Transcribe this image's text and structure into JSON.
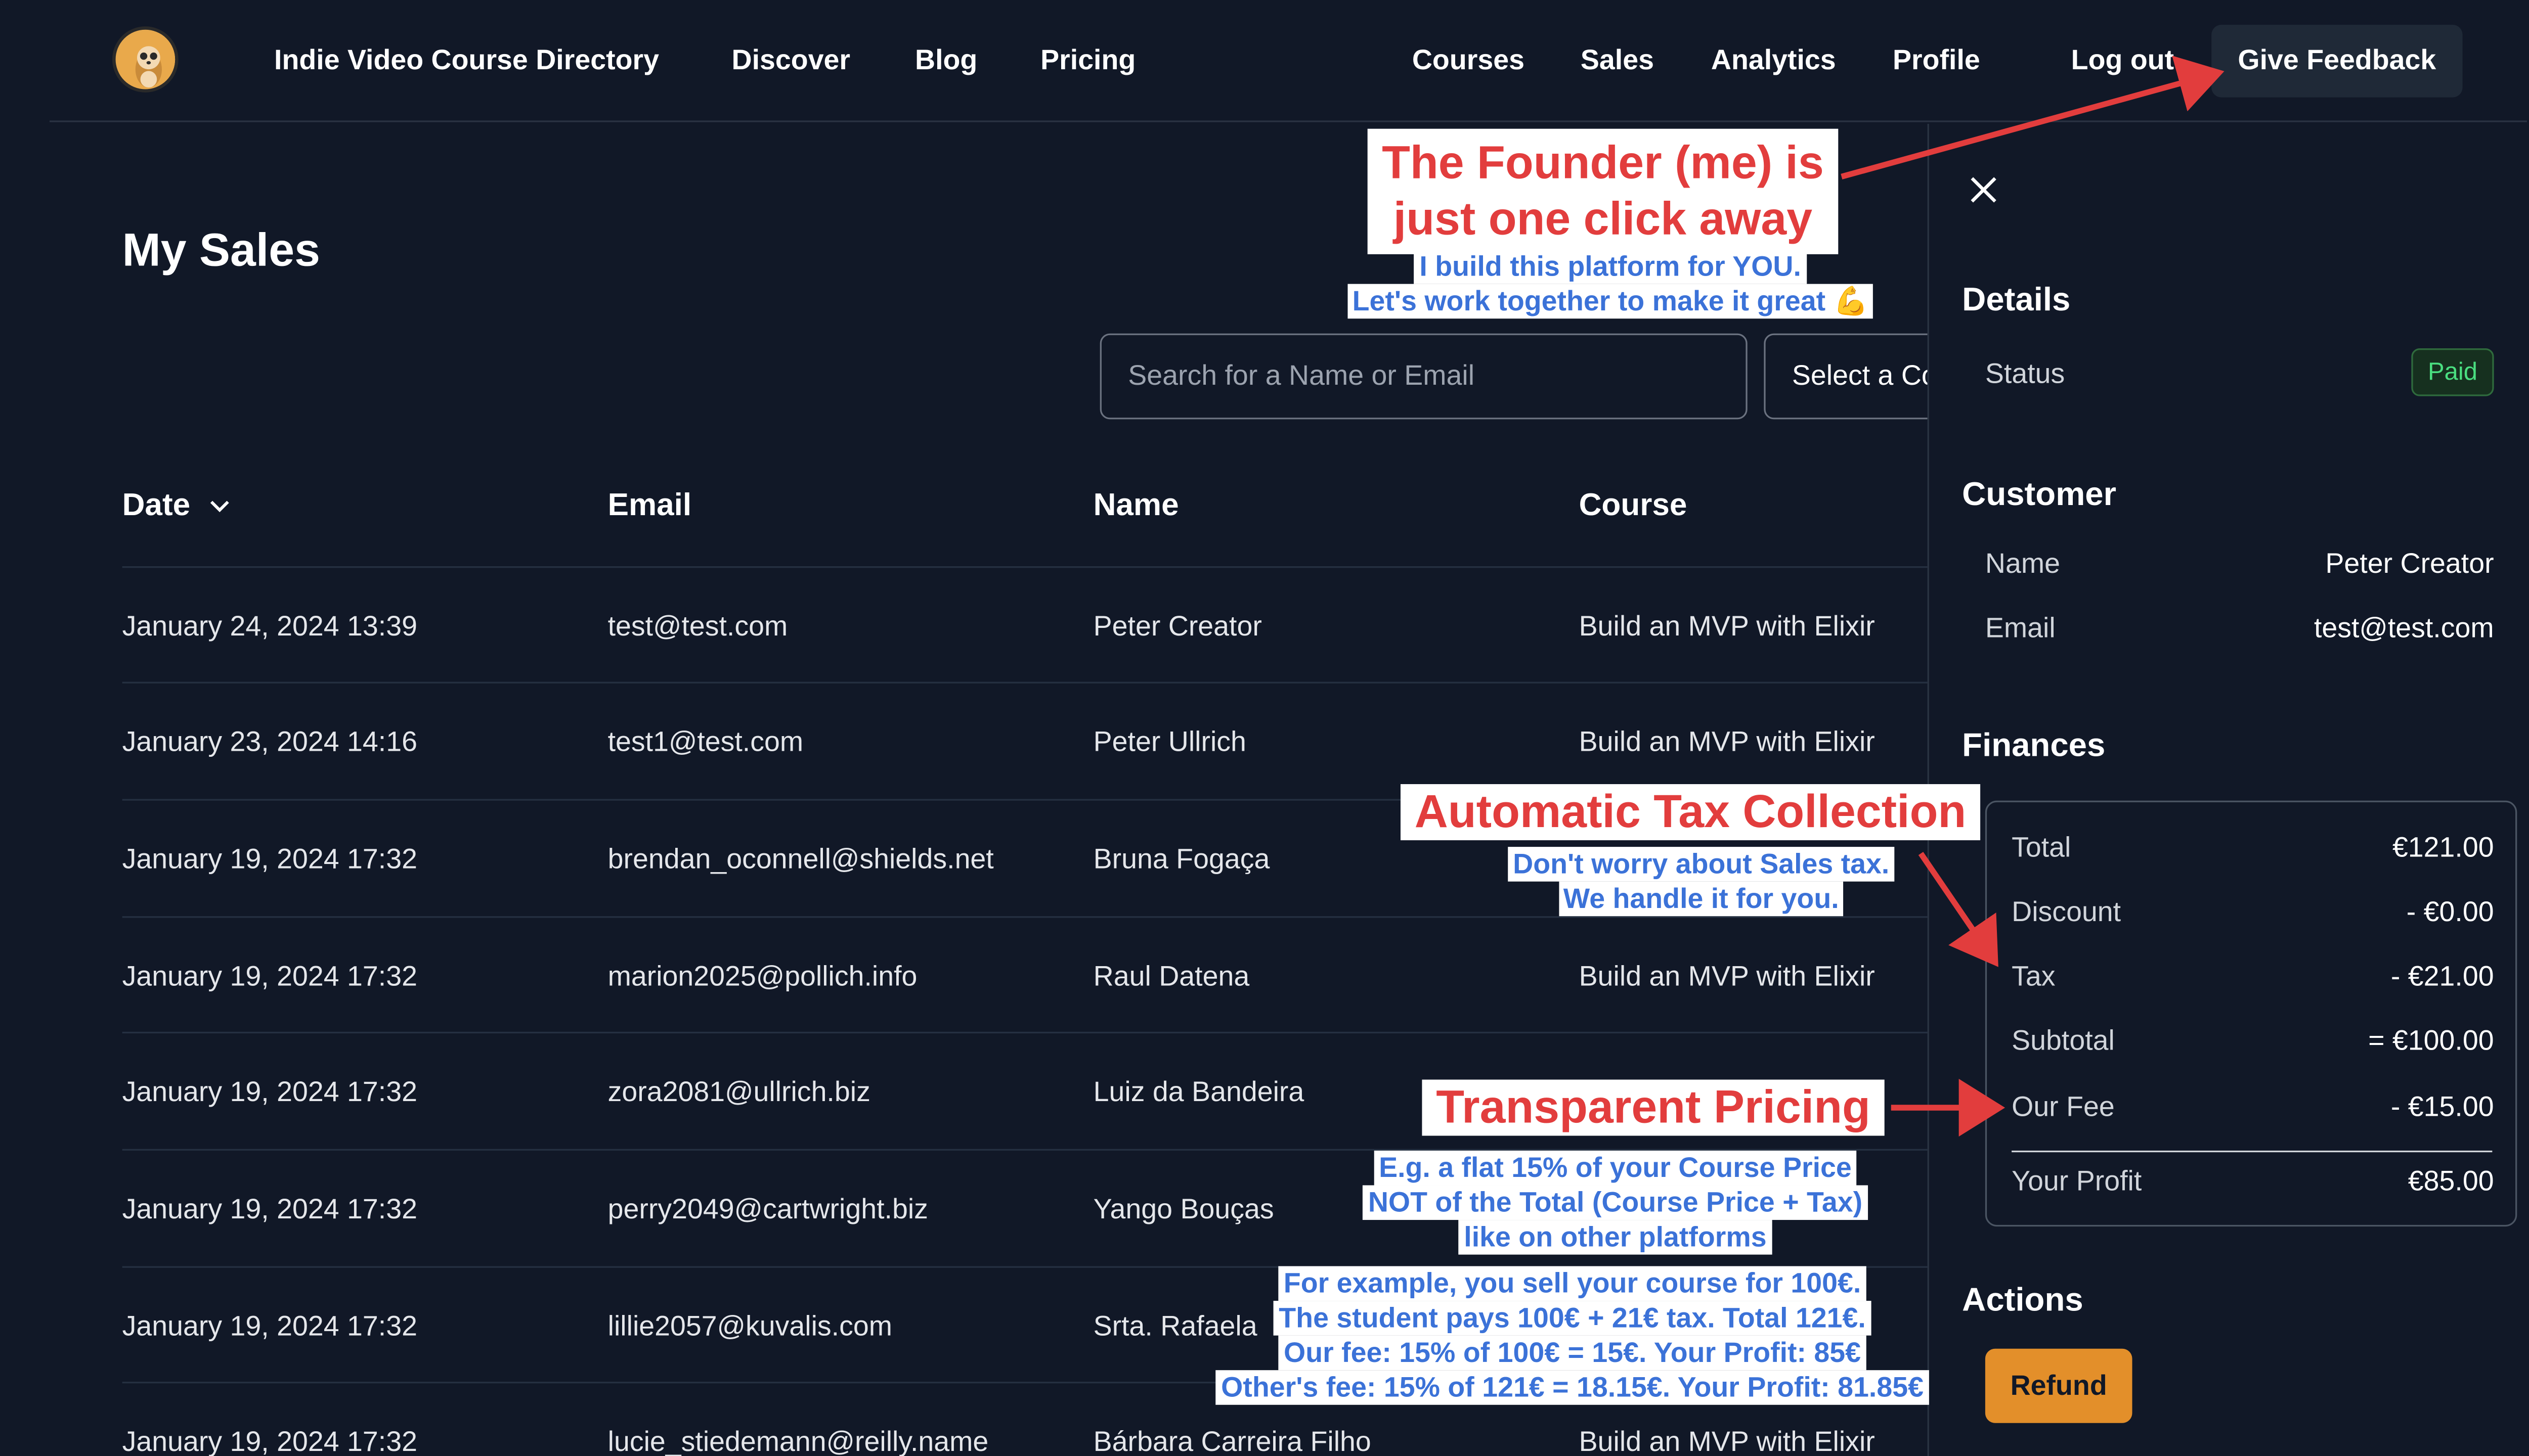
{
  "nav": {
    "brand": "Indie Video Course Directory",
    "left_links": [
      "Discover",
      "Blog",
      "Pricing"
    ],
    "right_links": [
      "Courses",
      "Sales",
      "Analytics",
      "Profile",
      "Log out"
    ],
    "feedback_label": "Give Feedback"
  },
  "page": {
    "title": "My Sales",
    "search_placeholder": "Search for a Name or Email",
    "course_select": "Select a Co"
  },
  "table": {
    "headers": [
      "Date",
      "Email",
      "Name",
      "Course"
    ],
    "rows": [
      {
        "date": "January 24, 2024 13:39",
        "email": "test@test.com",
        "name": "Peter Creator",
        "course": "Build an MVP with Elixir"
      },
      {
        "date": "January 23, 2024 14:16",
        "email": "test1@test.com",
        "name": "Peter Ullrich",
        "course": "Build an MVP with Elixir"
      },
      {
        "date": "January 19, 2024 17:32",
        "email": "brendan_oconnell@shields.net",
        "name": "Bruna Fogaça",
        "course": ""
      },
      {
        "date": "January 19, 2024 17:32",
        "email": "marion2025@pollich.info",
        "name": "Raul Datena",
        "course": "Build an MVP with Elixir"
      },
      {
        "date": "January 19, 2024 17:32",
        "email": "zora2081@ullrich.biz",
        "name": "Luiz da Bandeira",
        "course": ""
      },
      {
        "date": "January 19, 2024 17:32",
        "email": "perry2049@cartwright.biz",
        "name": "Yango Bouças",
        "course": ""
      },
      {
        "date": "January 19, 2024 17:32",
        "email": "lillie2057@kuvalis.com",
        "name": "Srta. Rafaela",
        "course": ""
      },
      {
        "date": "January 19, 2024 17:32",
        "email": "lucie_stiedemann@reilly.name",
        "name": "Bárbara Carreira Filho",
        "course": "Build an MVP with Elixir"
      }
    ]
  },
  "details": {
    "title": "Details",
    "status_label": "Status",
    "status_value": "Paid",
    "customer_title": "Customer",
    "name_label": "Name",
    "name_value": "Peter Creator",
    "email_label": "Email",
    "email_value": "test@test.com",
    "finances_title": "Finances",
    "finances": [
      {
        "label": "Total",
        "value": "€121.00"
      },
      {
        "label": "Discount",
        "value": "- €0.00"
      },
      {
        "label": "Tax",
        "value": "- €21.00"
      },
      {
        "label": "Subtotal",
        "value": "= €100.00"
      },
      {
        "label": "Our Fee",
        "value": "- €15.00"
      },
      {
        "label": "Your Profit",
        "value": "€85.00"
      }
    ],
    "actions_title": "Actions",
    "refund_label": "Refund"
  },
  "annotations": {
    "founder_title_1": "The Founder (me) is",
    "founder_title_2": "just one click away",
    "founder_sub_1": "I build this platform for YOU.",
    "founder_sub_2": "Let's work together to make it great 💪",
    "tax_title": "Automatic Tax Collection",
    "tax_sub_1": "Don't worry about Sales tax.",
    "tax_sub_2": "We handle it for you.",
    "pricing_title": "Transparent Pricing",
    "pricing_sub_1": "E.g. a flat 15% of your Course Price",
    "pricing_sub_2": "NOT of the Total (Course Price + Tax)",
    "pricing_sub_3": "like on other platforms",
    "example_1": "For example, you sell your course for 100€.",
    "example_2": "The student pays 100€ + 21€ tax. Total 121€.",
    "example_3": "Our fee: 15% of 100€ = 15€. Your Profit: 85€",
    "example_4": "Other's fee: 15% of 121€ = 18.15€. Your Profit:  81.85€"
  },
  "colors": {
    "background": "#111827",
    "annotation_red": "#e23d3d",
    "annotation_blue": "#3b72d8",
    "paid_green": "#4ade80",
    "refund_orange": "#e38f2a"
  },
  "icons": [
    "logo-icon",
    "chevron-down-icon",
    "close-icon"
  ]
}
